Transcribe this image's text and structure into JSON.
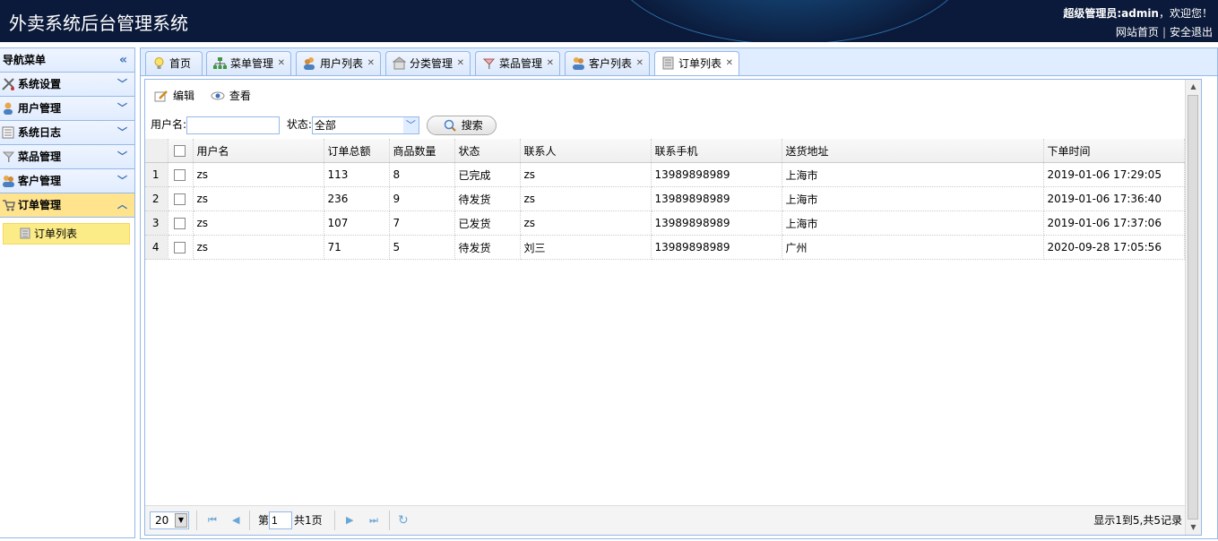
{
  "header": {
    "title": "外卖系统后台管理系统",
    "welcome_user": "超级管理员:admin",
    "welcome_suffix": "，欢迎您！",
    "links": [
      "网站首页",
      "安全退出"
    ]
  },
  "sidebar": {
    "title": "导航菜单",
    "items": [
      {
        "label": "系统设置",
        "icon": "tools-icon"
      },
      {
        "label": "用户管理",
        "icon": "user-icon"
      },
      {
        "label": "系统日志",
        "icon": "log-icon"
      },
      {
        "label": "菜品管理",
        "icon": "dish-icon"
      },
      {
        "label": "客户管理",
        "icon": "customer-icon"
      },
      {
        "label": "订单管理",
        "icon": "cart-icon",
        "expanded": true
      }
    ],
    "sub_items": [
      {
        "label": "订单列表",
        "icon": "order-list-icon",
        "selected": true
      }
    ]
  },
  "tabs": [
    {
      "label": "首页",
      "icon": "bulb-icon",
      "closable": false
    },
    {
      "label": "菜单管理",
      "icon": "sitemap-icon",
      "closable": true
    },
    {
      "label": "用户列表",
      "icon": "users-icon",
      "closable": true
    },
    {
      "label": "分类管理",
      "icon": "category-icon",
      "closable": true
    },
    {
      "label": "菜品管理",
      "icon": "dish-icon",
      "closable": true
    },
    {
      "label": "客户列表",
      "icon": "customers-icon",
      "closable": true
    },
    {
      "label": "订单列表",
      "icon": "order-icon",
      "closable": true,
      "selected": true
    }
  ],
  "toolbar": {
    "edit_label": "编辑",
    "view_label": "查看"
  },
  "search": {
    "username_label": "用户名:",
    "username_value": "",
    "status_label": "状态:",
    "status_value": "全部",
    "search_button": "搜索"
  },
  "grid": {
    "columns": [
      "用户名",
      "订单总额",
      "商品数量",
      "状态",
      "联系人",
      "联系手机",
      "送货地址",
      "下单时间"
    ],
    "rows": [
      {
        "num": "1",
        "cells": [
          "zs",
          "113",
          "8",
          "已完成",
          "zs",
          "13989898989",
          "上海市",
          "2019-01-06 17:29:05"
        ]
      },
      {
        "num": "2",
        "cells": [
          "zs",
          "236",
          "9",
          "待发货",
          "zs",
          "13989898989",
          "上海市",
          "2019-01-06 17:36:40"
        ]
      },
      {
        "num": "3",
        "cells": [
          "zs",
          "107",
          "7",
          "已发货",
          "zs",
          "13989898989",
          "上海市",
          "2019-01-06 17:37:06"
        ]
      },
      {
        "num": "4",
        "cells": [
          "zs",
          "71",
          "5",
          "待发货",
          "刘三",
          "13989898989",
          "广州",
          "2020-09-28 17:05:56"
        ]
      }
    ]
  },
  "pager": {
    "page_size": "20",
    "page_prefix": "第",
    "page_value": "1",
    "page_total": "共1页",
    "summary": "显示1到5,共5记录"
  }
}
